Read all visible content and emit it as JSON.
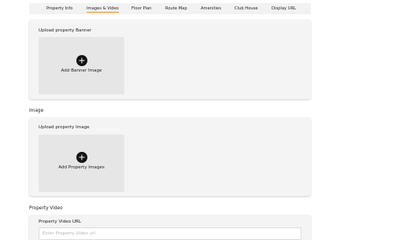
{
  "tabs": [
    {
      "label": "Property Info",
      "active": false
    },
    {
      "label": "Images & Video",
      "active": true
    },
    {
      "label": "Floor Plan",
      "active": false
    },
    {
      "label": "Route Map",
      "active": false
    },
    {
      "label": "Amenities",
      "active": false
    },
    {
      "label": "Club House",
      "active": false
    },
    {
      "label": "Display URL",
      "active": false
    }
  ],
  "banner": {
    "label": "Upload property Banner",
    "button_label": "Add Banner Image"
  },
  "image": {
    "heading": "Image",
    "label": "Upload property Image",
    "button_label": "Add Property Images"
  },
  "video": {
    "heading": "Property Video",
    "label": "Property Video URL",
    "placeholder": "Enter Property Video url"
  },
  "colors": {
    "active_tab_underline": "#e69138",
    "card_background": "#f4f4f4",
    "upload_box": "#e6e6e6"
  }
}
